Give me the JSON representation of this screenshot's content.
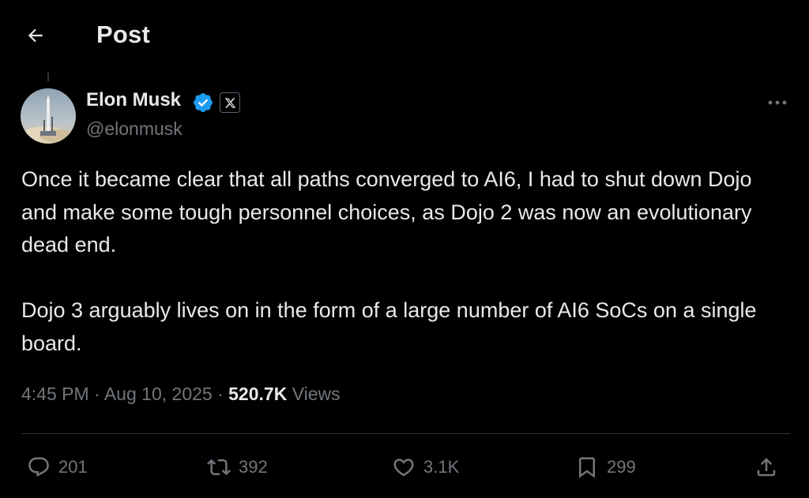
{
  "header": {
    "title": "Post"
  },
  "author": {
    "name": "Elon Musk",
    "handle": "@elonmusk",
    "affiliate_badge": "X"
  },
  "tweet": {
    "paragraphs": [
      "Once it became clear that all paths converged to AI6, I had to shut down Dojo and make some tough personnel choices, as Dojo 2 was now an evolutionary dead end.",
      "Dojo 3 arguably lives on in the form of a large number of AI6 SoCs on a single board."
    ]
  },
  "meta": {
    "time": "4:45 PM",
    "separator": "·",
    "date": "Aug 10, 2025",
    "views_count": "520.7K",
    "views_label": "Views"
  },
  "actions": {
    "replies": "201",
    "reposts": "392",
    "likes": "3.1K",
    "bookmarks": "299"
  },
  "icons": {
    "back": "arrow-left-icon",
    "verified": "verified-badge-icon",
    "more": "more-horizontal-icon",
    "reply": "reply-icon",
    "repost": "repost-icon",
    "like": "heart-icon",
    "bookmark": "bookmark-icon",
    "share": "share-icon"
  },
  "colors": {
    "background": "#000000",
    "text_primary": "#e7e9ea",
    "text_secondary": "#71767b",
    "verified_blue": "#1d9bf0",
    "divider": "#2f3336"
  }
}
